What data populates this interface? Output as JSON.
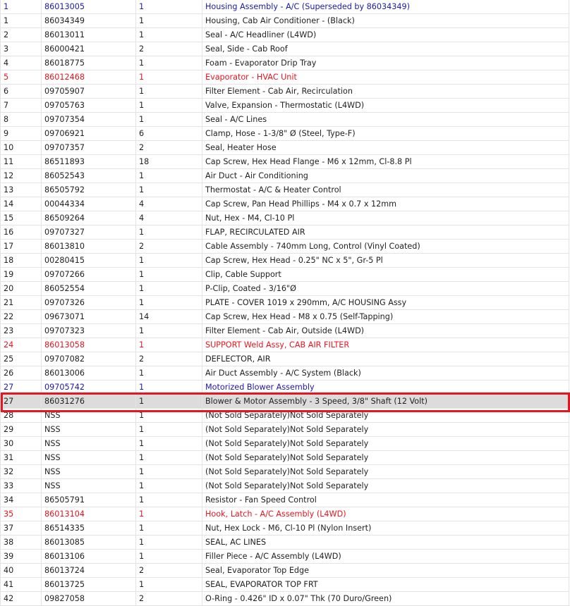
{
  "colors": {
    "accent_blue": "#1a1aa6",
    "accent_red": "#e8141e",
    "selected_bg": "#dcdcdc",
    "selection_outline": "#e8141e"
  },
  "rows": [
    {
      "ref": "1",
      "part": "86013005",
      "qty": "1",
      "desc": "Housing Assembly - A/C (Superseded by 86034349)",
      "style": "blue"
    },
    {
      "ref": "1",
      "part": "86034349",
      "qty": "1",
      "desc": "Housing, Cab Air Conditioner - (Black)",
      "style": "normal"
    },
    {
      "ref": "2",
      "part": "86013011",
      "qty": "1",
      "desc": "Seal - A/C Headliner (L4WD)",
      "style": "normal"
    },
    {
      "ref": "3",
      "part": "86000421",
      "qty": "2",
      "desc": "Seal, Side - Cab Roof",
      "style": "normal"
    },
    {
      "ref": "4",
      "part": "86018775",
      "qty": "1",
      "desc": "Foam - Evaporator Drip Tray",
      "style": "normal"
    },
    {
      "ref": "5",
      "part": "86012468",
      "qty": "1",
      "desc": "Evaporator - HVAC Unit",
      "style": "red"
    },
    {
      "ref": "6",
      "part": "09705907",
      "qty": "1",
      "desc": "Filter Element - Cab Air, Recirculation",
      "style": "normal"
    },
    {
      "ref": "7",
      "part": "09705763",
      "qty": "1",
      "desc": "Valve, Expansion - Thermostatic (L4WD)",
      "style": "normal"
    },
    {
      "ref": "8",
      "part": "09707354",
      "qty": "1",
      "desc": "Seal - A/C Lines",
      "style": "normal"
    },
    {
      "ref": "9",
      "part": "09706921",
      "qty": "6",
      "desc": "Clamp, Hose - 1-3/8\" Ø (Steel, Type-F)",
      "style": "normal"
    },
    {
      "ref": "10",
      "part": "09707357",
      "qty": "2",
      "desc": "Seal, Heater Hose",
      "style": "normal"
    },
    {
      "ref": "11",
      "part": "86511893",
      "qty": "18",
      "desc": "Cap Screw, Hex Head Flange - M6 x 12mm, Cl-8.8 Pl",
      "style": "normal"
    },
    {
      "ref": "12",
      "part": "86052543",
      "qty": "1",
      "desc": "Air Duct - Air Conditioning",
      "style": "normal"
    },
    {
      "ref": "13",
      "part": "86505792",
      "qty": "1",
      "desc": "Thermostat - A/C & Heater Control",
      "style": "normal"
    },
    {
      "ref": "14",
      "part": "00044334",
      "qty": "4",
      "desc": "Cap Screw, Pan Head Phillips - M4 x 0.7 x 12mm",
      "style": "normal"
    },
    {
      "ref": "15",
      "part": "86509264",
      "qty": "4",
      "desc": "Nut, Hex - M4, Cl-10 Pl",
      "style": "normal"
    },
    {
      "ref": "16",
      "part": "09707327",
      "qty": "1",
      "desc": "FLAP, RECIRCULATED AIR",
      "style": "normal"
    },
    {
      "ref": "17",
      "part": "86013810",
      "qty": "2",
      "desc": "Cable Assembly - 740mm Long, Control (Vinyl Coated)",
      "style": "normal"
    },
    {
      "ref": "18",
      "part": "00280415",
      "qty": "1",
      "desc": "Cap Screw, Hex Head - 0.25\" NC x 5\", Gr-5 Pl",
      "style": "normal"
    },
    {
      "ref": "19",
      "part": "09707266",
      "qty": "1",
      "desc": "Clip, Cable Support",
      "style": "normal"
    },
    {
      "ref": "20",
      "part": "86052554",
      "qty": "1",
      "desc": "P-Clip, Coated - 3/16\"Ø",
      "style": "normal"
    },
    {
      "ref": "21",
      "part": "09707326",
      "qty": "1",
      "desc": "PLATE - COVER 1019 x 290mm, A/C HOUSING Assy",
      "style": "normal"
    },
    {
      "ref": "22",
      "part": "09673071",
      "qty": "14",
      "desc": "Cap Screw, Hex Head - M8 x 0.75 (Self-Tapping)",
      "style": "normal"
    },
    {
      "ref": "23",
      "part": "09707323",
      "qty": "1",
      "desc": "Filter Element - Cab Air, Outside (L4WD)",
      "style": "normal"
    },
    {
      "ref": "24",
      "part": "86013058",
      "qty": "1",
      "desc": "SUPPORT Weld Assy, CAB AIR FILTER",
      "style": "red"
    },
    {
      "ref": "25",
      "part": "09707082",
      "qty": "2",
      "desc": "DEFLECTOR, AIR",
      "style": "normal"
    },
    {
      "ref": "26",
      "part": "86013006",
      "qty": "1",
      "desc": "Air Duct Assembly - A/C System (Black)",
      "style": "normal"
    },
    {
      "ref": "27",
      "part": "09705742",
      "qty": "1",
      "desc": "Motorized Blower Assembly",
      "style": "blue"
    },
    {
      "ref": "27",
      "part": "86031276",
      "qty": "1",
      "desc": "Blower & Motor Assembly - 3 Speed, 3/8\" Shaft (12 Volt)",
      "style": "selected"
    },
    {
      "ref": "28",
      "part": "NSS",
      "qty": "1",
      "desc": "(Not Sold Separately)Not Sold Separately",
      "style": "normal"
    },
    {
      "ref": "29",
      "part": "NSS",
      "qty": "1",
      "desc": "(Not Sold Separately)Not Sold Separately",
      "style": "normal"
    },
    {
      "ref": "30",
      "part": "NSS",
      "qty": "1",
      "desc": "(Not Sold Separately)Not Sold Separately",
      "style": "normal"
    },
    {
      "ref": "31",
      "part": "NSS",
      "qty": "1",
      "desc": "(Not Sold Separately)Not Sold Separately",
      "style": "normal"
    },
    {
      "ref": "32",
      "part": "NSS",
      "qty": "1",
      "desc": "(Not Sold Separately)Not Sold Separately",
      "style": "normal"
    },
    {
      "ref": "33",
      "part": "NSS",
      "qty": "1",
      "desc": "(Not Sold Separately)Not Sold Separately",
      "style": "normal"
    },
    {
      "ref": "34",
      "part": "86505791",
      "qty": "1",
      "desc": "Resistor - Fan Speed Control",
      "style": "normal"
    },
    {
      "ref": "35",
      "part": "86013104",
      "qty": "1",
      "desc": "Hook, Latch - A/C Assembly (L4WD)",
      "style": "red"
    },
    {
      "ref": "37",
      "part": "86514335",
      "qty": "1",
      "desc": "Nut, Hex Lock - M6, Cl-10 Pl (Nylon Insert)",
      "style": "normal"
    },
    {
      "ref": "38",
      "part": "86013085",
      "qty": "1",
      "desc": "SEAL, AC LINES",
      "style": "normal"
    },
    {
      "ref": "39",
      "part": "86013106",
      "qty": "1",
      "desc": "Filler Piece - A/C Assembly (L4WD)",
      "style": "normal"
    },
    {
      "ref": "40",
      "part": "86013724",
      "qty": "2",
      "desc": "Seal, Evaporator Top Edge",
      "style": "normal"
    },
    {
      "ref": "41",
      "part": "86013725",
      "qty": "1",
      "desc": "SEAL, EVAPORATOR TOP FRT",
      "style": "normal"
    },
    {
      "ref": "42",
      "part": "09827058",
      "qty": "2",
      "desc": "O-Ring - 0.426\" ID x 0.07\" Thk (70 Duro/Green)",
      "style": "normal"
    }
  ]
}
